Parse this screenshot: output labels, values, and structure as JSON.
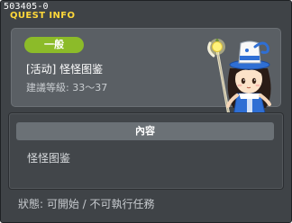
{
  "window": {
    "quest_id": "503405-0",
    "title": "QUEST INFO"
  },
  "quest": {
    "level_badge": "一般",
    "name": "[活动] 怪怪图鉴",
    "recommended_level": "建議等級: 33～37"
  },
  "content": {
    "header": "內容",
    "body": "怪怪图鉴"
  },
  "status": {
    "text": "狀態: 可開始 / 不可執行任務"
  },
  "colors": {
    "title_yellow": "#ffd83a",
    "badge_green": "#8cbb29",
    "window_bg": "#3f4347",
    "panel_bg": "#5a5f64"
  }
}
